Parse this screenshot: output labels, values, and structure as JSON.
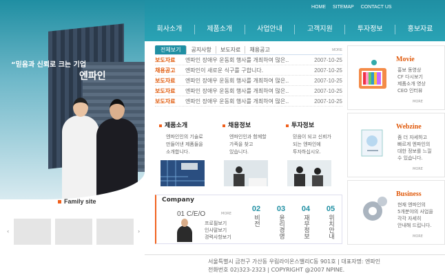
{
  "top_links": [
    "HOME",
    "SITEMAP",
    "CONTACT US"
  ],
  "nav": [
    "회사소개",
    "제품소개",
    "사업안내",
    "고객지원",
    "투자정보",
    "홍보자료"
  ],
  "hero": {
    "slogan": "“믿음과 신뢰로 크는 기업",
    "brand": "엔파인"
  },
  "family_site": {
    "title": "Family site"
  },
  "news": {
    "tabs": [
      "전체보기",
      "공지사항",
      "보도자료",
      "채용공고"
    ],
    "more": "MORE",
    "rows": [
      {
        "cat": "보도자료",
        "title": "엔파인 장애우 운동회 행사를 개최하여 많은..",
        "date": "2007-10-25"
      },
      {
        "cat": "채용공고",
        "title": "엔파인이 새로운 식구를 구합니다.",
        "date": "2007-10-25"
      },
      {
        "cat": "보도자료",
        "title": "엔파인 장애우 운동회 행사를 개최하여 많은..",
        "date": "2007-10-25"
      },
      {
        "cat": "보도자료",
        "title": "엔파인 장애우 운동회 행사를 개최하여 많은..",
        "date": "2007-10-25"
      },
      {
        "cat": "보도자료",
        "title": "엔파인 장애우 운동회 행사를 개최하여 많은..",
        "date": "2007-10-25"
      }
    ]
  },
  "info_cols": [
    {
      "title": "제품소개",
      "lines": [
        "엔파인인의 기술로",
        "만들어낸 제품들을",
        "소개합니다."
      ]
    },
    {
      "title": "채용정보",
      "lines": [
        "엔파인인과 함께할",
        "가족을 찾고",
        "있습니다."
      ]
    },
    {
      "title": "투자정보",
      "lines": [
        "믿음이 되고 신뢰가",
        "되는 엔파인에",
        "투자하십시오."
      ]
    }
  ],
  "company": {
    "title": "Company",
    "ceo_label": "01 C/E/O",
    "more": "MORE",
    "links": [
      "프로필보기",
      "인사말보기",
      "경력사항보기"
    ],
    "items": [
      {
        "num": "02",
        "label": "비전"
      },
      {
        "num": "03",
        "label": "윤리경영"
      },
      {
        "num": "04",
        "label": "재무정보"
      },
      {
        "num": "05",
        "label": "위치안내"
      }
    ]
  },
  "cards": [
    {
      "title": "Movie",
      "lines": [
        "홍보 동영상",
        "CF 다시보기",
        "제품소개 영상",
        "CEO 인터뷰"
      ],
      "more": "MORE"
    },
    {
      "title": "Webzine",
      "lines": [
        "좀 더 자세하고",
        "빠르게 엔파인의",
        "대한 정보를 느낄",
        "수 있습니다."
      ],
      "more": "MORE"
    },
    {
      "title": "Business",
      "lines": [
        "현재 엔파인의",
        "5개분야의 사업을",
        "각각 자세히",
        "안내해 드립니다."
      ],
      "more": "MORE"
    }
  ],
  "footer": {
    "line1": "서울특별시 금천구 가산동 우림라이온스밸리C동 901호  |  대표자명: 엔파인",
    "line2": "전화번호 02)323-2323  |  COPYRIGHT @2007 NPINE."
  },
  "colors": {
    "brand": "#1f8fa3",
    "accent": "#e05a0c"
  }
}
